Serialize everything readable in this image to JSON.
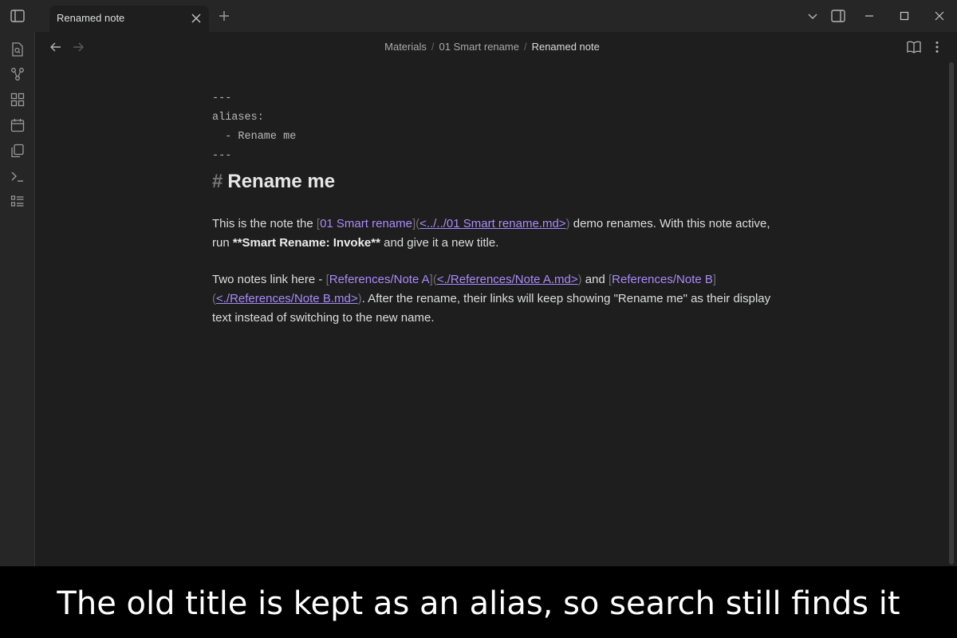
{
  "tab": {
    "title": "Renamed note"
  },
  "breadcrumb": {
    "items": [
      "Materials",
      "01 Smart rename"
    ],
    "separator": "/",
    "current": "Renamed note"
  },
  "frontmatter": {
    "open": "---",
    "key": "aliases:",
    "item": "  - Rename me",
    "close": "---"
  },
  "heading": {
    "marker": "#",
    "text": "Rename me"
  },
  "paragraph1": {
    "t1": "This is the note the ",
    "link_text": "01 Smart rename",
    "link_url": "<../../01 Smart rename.md>",
    "t2": " demo renames. With this note active, run ",
    "bold": "**Smart Rename: Invoke**",
    "t3": " and give it a new title."
  },
  "paragraph2": {
    "t1": "Two notes link here - ",
    "linkA_text": "References/Note A",
    "linkA_url": "<./References/Note A.md>",
    "t2": " and ",
    "linkB_text": "References/Note B",
    "linkB_url": "<./References/Note B.md>",
    "t3": ". After the rename, their links will keep showing \"Rename me\" as their display text instead of switching to the new name."
  },
  "brackets": {
    "open": "[",
    "close": "]",
    "popen": "(",
    "pclose": ")"
  },
  "caption": "The old title is kept as an alias, so search still finds it",
  "icons": [
    "sidebar-toggle-icon",
    "close-icon",
    "plus-icon",
    "chevron-down-icon",
    "right-sidebar-icon",
    "minimize-icon",
    "maximize-icon",
    "window-close-icon",
    "back-arrow-icon",
    "forward-arrow-icon",
    "reading-view-icon",
    "more-options-icon",
    "file-search-icon",
    "graph-view-icon",
    "canvas-icon",
    "calendar-icon",
    "templates-icon",
    "terminal-icon",
    "command-palette-icon"
  ],
  "colors": {
    "link": "#a88bfa",
    "background": "#1e1e1e",
    "chrome": "#262626"
  }
}
